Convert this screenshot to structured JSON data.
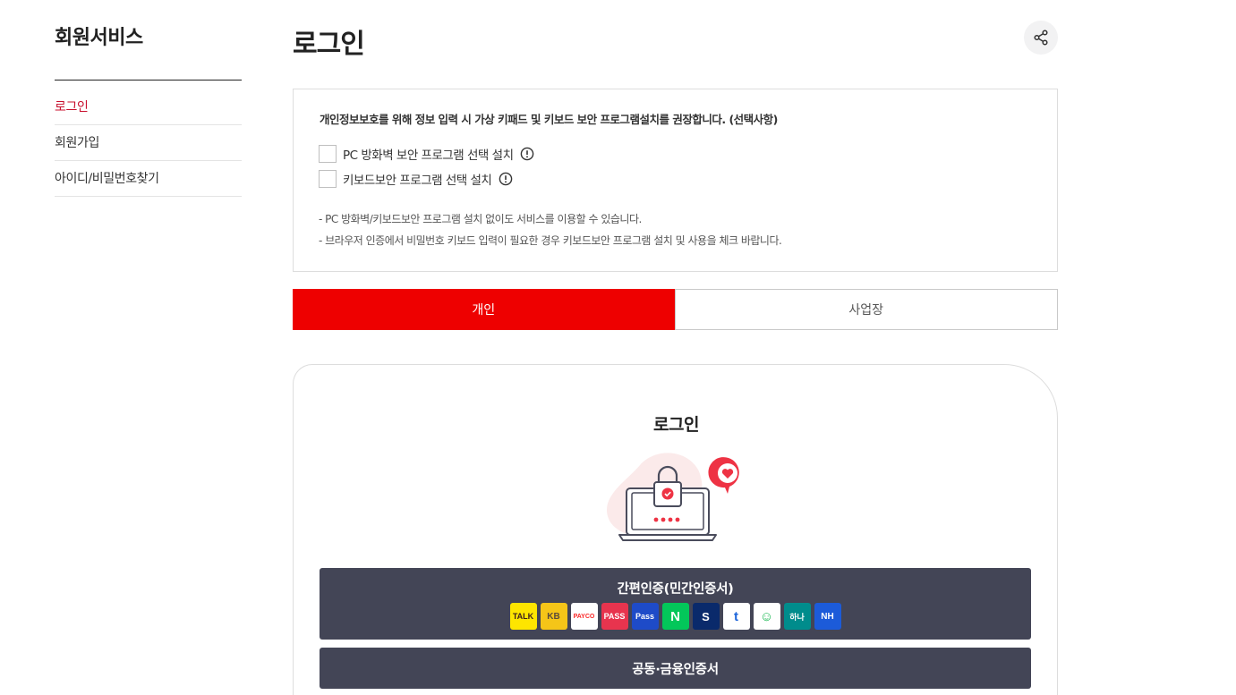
{
  "sidebar": {
    "title": "회원서비스",
    "items": [
      {
        "label": "로그인",
        "active": true
      },
      {
        "label": "회원가입",
        "active": false
      },
      {
        "label": "아이디/비밀번호찾기",
        "active": false
      }
    ]
  },
  "header": {
    "title": "로그인",
    "share_icon": "share-icon"
  },
  "notice": {
    "heading": "개인정보보호를 위해 정보 입력 시 가상 키패드 및 키보드 보안 프로그램설치를 권장합니다. (선택사항)",
    "options": [
      {
        "label": "PC 방화벽 보안 프로그램 선택 설치",
        "checked": false
      },
      {
        "label": "키보드보안 프로그램 선택 설치",
        "checked": false
      }
    ],
    "notes": [
      "-  PC 방화벽/키보드보안 프로그램 설치 없이도 서비스를 이용할 수 있습니다.",
      "-  브라우저 인증에서 비밀번호 키보드 입력이 필요한 경우 키보드보안 프로그램 설치 및 사용을 체크 바랍니다."
    ]
  },
  "tabs": [
    {
      "label": "개인",
      "active": true
    },
    {
      "label": "사업장",
      "active": false
    }
  ],
  "login": {
    "title": "로그인",
    "simple_auth_label": "간편인증(민간인증서)",
    "cert_label": "공동·금융인증서",
    "providers": [
      {
        "name": "kakao-icon",
        "text": "TALK",
        "bg": "#FEE500",
        "fg": "#3C1E1E"
      },
      {
        "name": "kb-icon",
        "text": "KB",
        "bg": "#F5C518",
        "fg": "#5A4A3A"
      },
      {
        "name": "payco-icon",
        "text": "PAYCO",
        "bg": "#FFFFFF",
        "fg": "#FA2828"
      },
      {
        "name": "pass-icon",
        "text": "PASS",
        "bg": "#E8344E",
        "fg": "#FFFFFF"
      },
      {
        "name": "samsung-pass-icon",
        "text": "Pass",
        "bg": "#1E4BC8",
        "fg": "#FFFFFF"
      },
      {
        "name": "naver-icon",
        "text": "N",
        "bg": "#03C75A",
        "fg": "#FFFFFF"
      },
      {
        "name": "shinhan-icon",
        "text": "S",
        "bg": "#0A2A6B",
        "fg": "#FFFFFF"
      },
      {
        "name": "toss-icon",
        "text": "t",
        "bg": "#FFFFFF",
        "fg": "#1B64DA"
      },
      {
        "name": "banksalad-icon",
        "text": "☺",
        "bg": "#FFFFFF",
        "fg": "#1DB954"
      },
      {
        "name": "hana-icon",
        "text": "하나",
        "bg": "#008C8C",
        "fg": "#FFFFFF"
      },
      {
        "name": "nh-icon",
        "text": "NH",
        "bg": "#1C5BD9",
        "fg": "#FFFFFF"
      }
    ]
  },
  "colors": {
    "accent": "#EE0000",
    "active_menu": "#C8102E",
    "button_dark": "#434556"
  }
}
